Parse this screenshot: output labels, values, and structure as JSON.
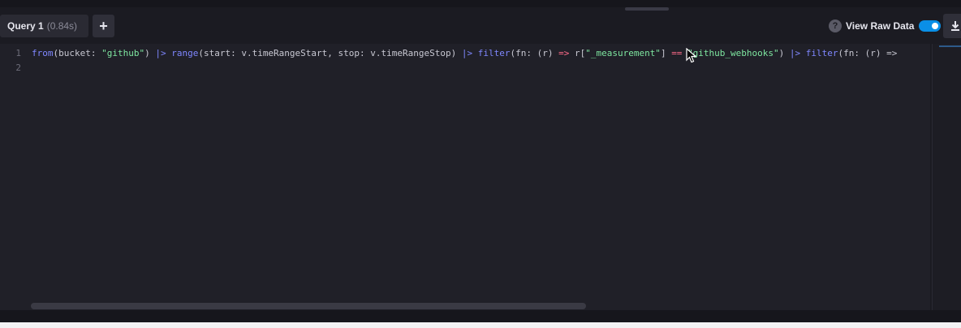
{
  "toolbar": {
    "query_tab_label": "Query 1",
    "query_tab_time": "(0.84s)",
    "add_query_label": "+",
    "help_icon_glyph": "?",
    "raw_data_label": "View Raw Data",
    "raw_data_enabled": true,
    "download_icon": "download-icon"
  },
  "editor": {
    "line_numbers": [
      "1",
      "2"
    ],
    "code": {
      "t1": "from",
      "t2": "(bucket: ",
      "t3": "\"github\"",
      "t4": ") ",
      "t5": "|>",
      "t6": " ",
      "t7": "range",
      "t8": "(start: v.timeRangeStart, stop: v.timeRangeStop) ",
      "t9": "|>",
      "t10": " ",
      "t11": "filter",
      "t12": "(fn: (r) ",
      "t13": "=>",
      "t14": " r[",
      "t15": "\"_measurement\"",
      "t16": "] ",
      "t17": "==",
      "t18": " ",
      "t19": "\"github_webhooks\"",
      "t20": ") ",
      "t21": "|>",
      "t22": " ",
      "t23": "filter",
      "t24": "(fn: (r) =>"
    }
  },
  "colors": {
    "accent": "#0a8fe6",
    "keyword": "#7f87ff",
    "string": "#7ee6a0",
    "operator": "#ff6b8a"
  }
}
